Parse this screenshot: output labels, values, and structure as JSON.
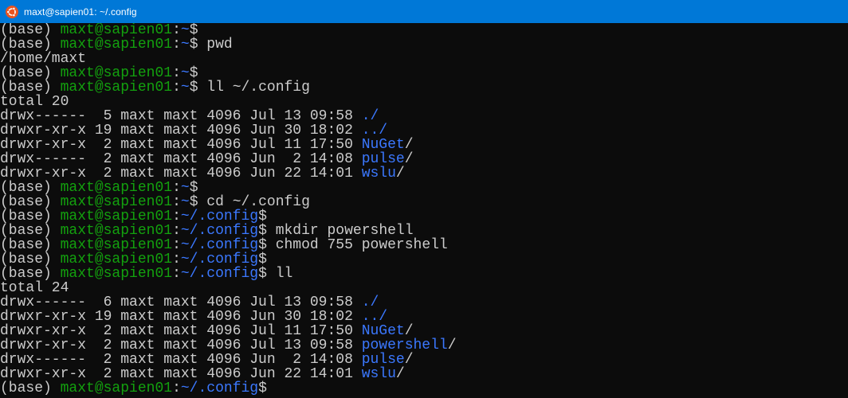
{
  "window": {
    "title": "maxt@sapien01: ~/.config",
    "icon": "ubuntu-icon",
    "titlebar_color": "#0078d7"
  },
  "colors": {
    "background": "#0c0c0c",
    "text": "#cccccc",
    "user_host": "#13a10e",
    "path_and_dirs": "#3b78ff"
  },
  "terminal": {
    "lines": [
      [
        {
          "t": "(base) ",
          "c": "w"
        },
        {
          "t": "maxt@sapien01",
          "c": "g"
        },
        {
          "t": ":",
          "c": "w"
        },
        {
          "t": "~",
          "c": "b"
        },
        {
          "t": "$",
          "c": "w"
        }
      ],
      [
        {
          "t": "(base) ",
          "c": "w"
        },
        {
          "t": "maxt@sapien01",
          "c": "g"
        },
        {
          "t": ":",
          "c": "w"
        },
        {
          "t": "~",
          "c": "b"
        },
        {
          "t": "$ pwd",
          "c": "w"
        }
      ],
      [
        {
          "t": "/home/maxt",
          "c": "w"
        }
      ],
      [
        {
          "t": "(base) ",
          "c": "w"
        },
        {
          "t": "maxt@sapien01",
          "c": "g"
        },
        {
          "t": ":",
          "c": "w"
        },
        {
          "t": "~",
          "c": "b"
        },
        {
          "t": "$",
          "c": "w"
        }
      ],
      [
        {
          "t": "(base) ",
          "c": "w"
        },
        {
          "t": "maxt@sapien01",
          "c": "g"
        },
        {
          "t": ":",
          "c": "w"
        },
        {
          "t": "~",
          "c": "b"
        },
        {
          "t": "$ ll ~/.config",
          "c": "w"
        }
      ],
      [
        {
          "t": "total 20",
          "c": "w"
        }
      ],
      [
        {
          "t": "drwx------  5 maxt maxt 4096 Jul 13 09:58 ",
          "c": "w"
        },
        {
          "t": "./",
          "c": "b"
        }
      ],
      [
        {
          "t": "drwxr-xr-x 19 maxt maxt 4096 Jun 30 18:02 ",
          "c": "w"
        },
        {
          "t": "../",
          "c": "b"
        }
      ],
      [
        {
          "t": "drwxr-xr-x  2 maxt maxt 4096 Jul 11 17:50 ",
          "c": "w"
        },
        {
          "t": "NuGet",
          "c": "b"
        },
        {
          "t": "/",
          "c": "w"
        }
      ],
      [
        {
          "t": "drwx------  2 maxt maxt 4096 Jun  2 14:08 ",
          "c": "w"
        },
        {
          "t": "pulse",
          "c": "b"
        },
        {
          "t": "/",
          "c": "w"
        }
      ],
      [
        {
          "t": "drwxr-xr-x  2 maxt maxt 4096 Jun 22 14:01 ",
          "c": "w"
        },
        {
          "t": "wslu",
          "c": "b"
        },
        {
          "t": "/",
          "c": "w"
        }
      ],
      [
        {
          "t": "(base) ",
          "c": "w"
        },
        {
          "t": "maxt@sapien01",
          "c": "g"
        },
        {
          "t": ":",
          "c": "w"
        },
        {
          "t": "~",
          "c": "b"
        },
        {
          "t": "$",
          "c": "w"
        }
      ],
      [
        {
          "t": "(base) ",
          "c": "w"
        },
        {
          "t": "maxt@sapien01",
          "c": "g"
        },
        {
          "t": ":",
          "c": "w"
        },
        {
          "t": "~",
          "c": "b"
        },
        {
          "t": "$ cd ~/.config",
          "c": "w"
        }
      ],
      [
        {
          "t": "(base) ",
          "c": "w"
        },
        {
          "t": "maxt@sapien01",
          "c": "g"
        },
        {
          "t": ":",
          "c": "w"
        },
        {
          "t": "~/.config",
          "c": "b"
        },
        {
          "t": "$",
          "c": "w"
        }
      ],
      [
        {
          "t": "(base) ",
          "c": "w"
        },
        {
          "t": "maxt@sapien01",
          "c": "g"
        },
        {
          "t": ":",
          "c": "w"
        },
        {
          "t": "~/.config",
          "c": "b"
        },
        {
          "t": "$ mkdir powershell",
          "c": "w"
        }
      ],
      [
        {
          "t": "(base) ",
          "c": "w"
        },
        {
          "t": "maxt@sapien01",
          "c": "g"
        },
        {
          "t": ":",
          "c": "w"
        },
        {
          "t": "~/.config",
          "c": "b"
        },
        {
          "t": "$ chmod 755 powershell",
          "c": "w"
        }
      ],
      [
        {
          "t": "(base) ",
          "c": "w"
        },
        {
          "t": "maxt@sapien01",
          "c": "g"
        },
        {
          "t": ":",
          "c": "w"
        },
        {
          "t": "~/.config",
          "c": "b"
        },
        {
          "t": "$",
          "c": "w"
        }
      ],
      [
        {
          "t": "(base) ",
          "c": "w"
        },
        {
          "t": "maxt@sapien01",
          "c": "g"
        },
        {
          "t": ":",
          "c": "w"
        },
        {
          "t": "~/.config",
          "c": "b"
        },
        {
          "t": "$ ll",
          "c": "w"
        }
      ],
      [
        {
          "t": "total 24",
          "c": "w"
        }
      ],
      [
        {
          "t": "drwx------  6 maxt maxt 4096 Jul 13 09:58 ",
          "c": "w"
        },
        {
          "t": "./",
          "c": "b"
        }
      ],
      [
        {
          "t": "drwxr-xr-x 19 maxt maxt 4096 Jun 30 18:02 ",
          "c": "w"
        },
        {
          "t": "../",
          "c": "b"
        }
      ],
      [
        {
          "t": "drwxr-xr-x  2 maxt maxt 4096 Jul 11 17:50 ",
          "c": "w"
        },
        {
          "t": "NuGet",
          "c": "b"
        },
        {
          "t": "/",
          "c": "w"
        }
      ],
      [
        {
          "t": "drwxr-xr-x  2 maxt maxt 4096 Jul 13 09:58 ",
          "c": "w"
        },
        {
          "t": "powershell",
          "c": "b"
        },
        {
          "t": "/",
          "c": "w"
        }
      ],
      [
        {
          "t": "drwx------  2 maxt maxt 4096 Jun  2 14:08 ",
          "c": "w"
        },
        {
          "t": "pulse",
          "c": "b"
        },
        {
          "t": "/",
          "c": "w"
        }
      ],
      [
        {
          "t": "drwxr-xr-x  2 maxt maxt 4096 Jun 22 14:01 ",
          "c": "w"
        },
        {
          "t": "wslu",
          "c": "b"
        },
        {
          "t": "/",
          "c": "w"
        }
      ],
      [
        {
          "t": "(base) ",
          "c": "w"
        },
        {
          "t": "maxt@sapien01",
          "c": "g"
        },
        {
          "t": ":",
          "c": "w"
        },
        {
          "t": "~/.config",
          "c": "b"
        },
        {
          "t": "$",
          "c": "w"
        }
      ]
    ]
  }
}
